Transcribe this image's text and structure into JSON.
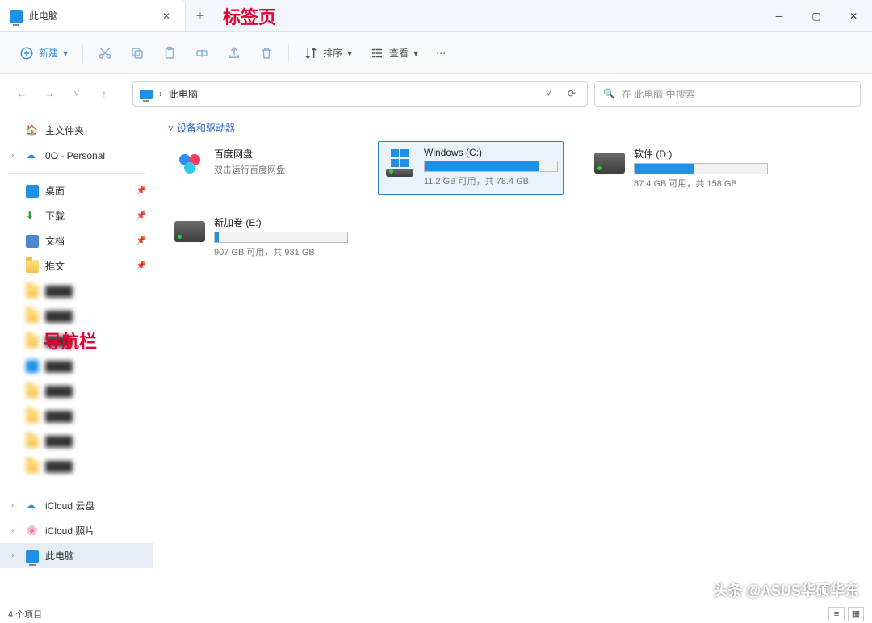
{
  "annotations": {
    "tabs": "标签页",
    "nav": "导航栏"
  },
  "tab": {
    "title": "此电脑"
  },
  "toolbar": {
    "new_label": "新建",
    "sort_label": "排序",
    "view_label": "查看"
  },
  "breadcrumb": {
    "location": "此电脑"
  },
  "search": {
    "placeholder": "在 此电脑 中搜索"
  },
  "nav": {
    "home": "主文件夹",
    "onedrive": "0O - Personal",
    "desktop": "桌面",
    "downloads": "下载",
    "documents": "文档",
    "tweets": "推文",
    "icloud_drive": "iCloud 云盘",
    "icloud_photos": "iCloud 照片",
    "this_pc": "此电脑"
  },
  "group_header": "设备和驱动器",
  "drives": [
    {
      "name": "百度网盘",
      "sub": "双击运行百度网盘",
      "bar": null,
      "kind": "app"
    },
    {
      "name": "Windows (C:)",
      "sub": "11.2 GB 可用，共 78.4 GB",
      "bar": 86,
      "kind": "win",
      "selected": true
    },
    {
      "name": "软件 (D:)",
      "sub": "87.4 GB 可用，共 158 GB",
      "bar": 45,
      "kind": "hdd"
    },
    {
      "name": "新加卷 (E:)",
      "sub": "907 GB 可用，共 931 GB",
      "bar": 3,
      "kind": "hdd"
    }
  ],
  "status": {
    "count": "4 个项目"
  },
  "watermark": "头条 @ASUS华硕华东"
}
